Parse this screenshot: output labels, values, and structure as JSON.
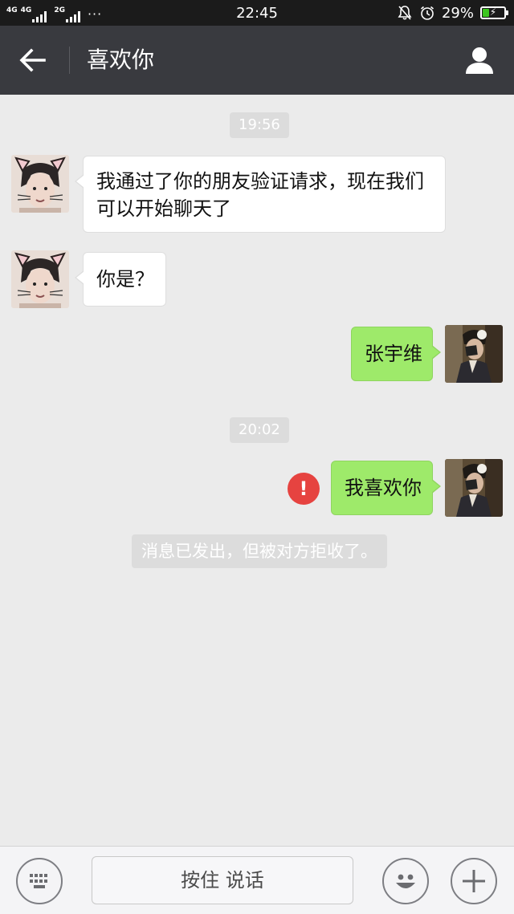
{
  "status_bar": {
    "network_1": "4G",
    "network_2": "4G",
    "network_3": "2G",
    "more": "···",
    "time": "22:45",
    "battery_percent": "29%",
    "battery_level": 0.29,
    "icons": [
      "mute-bell-icon",
      "alarm-icon",
      "battery-charging-icon"
    ]
  },
  "header": {
    "title": "喜欢你",
    "back_icon": "arrow-left-icon",
    "profile_icon": "person-icon"
  },
  "chat": {
    "timestamps": [
      "19:56",
      "20:02"
    ],
    "messages": [
      {
        "side": "in",
        "lines": [
          "我通过了你的朋友验证请求，现在我们",
          "可以开始聊天了"
        ]
      },
      {
        "side": "in",
        "lines": [
          "你是？"
        ]
      },
      {
        "side": "out",
        "lines": [
          "张宇维"
        ]
      },
      {
        "side": "out",
        "lines": [
          "我喜欢你"
        ],
        "status": "failed"
      }
    ],
    "system_notice": "消息已发出，但被对方拒收了。",
    "error_mark": "!"
  },
  "input_bar": {
    "hold_to_talk": "按住 说话",
    "icons": [
      "keyboard-icon",
      "emoji-icon",
      "plus-icon"
    ]
  },
  "colors": {
    "title_bar": "#393a3f",
    "status_bar": "#1b1b1b",
    "chat_bg": "#ebebeb",
    "outgoing_bubble": "#9eea6a",
    "incoming_bubble": "#ffffff",
    "error": "#e64340"
  }
}
